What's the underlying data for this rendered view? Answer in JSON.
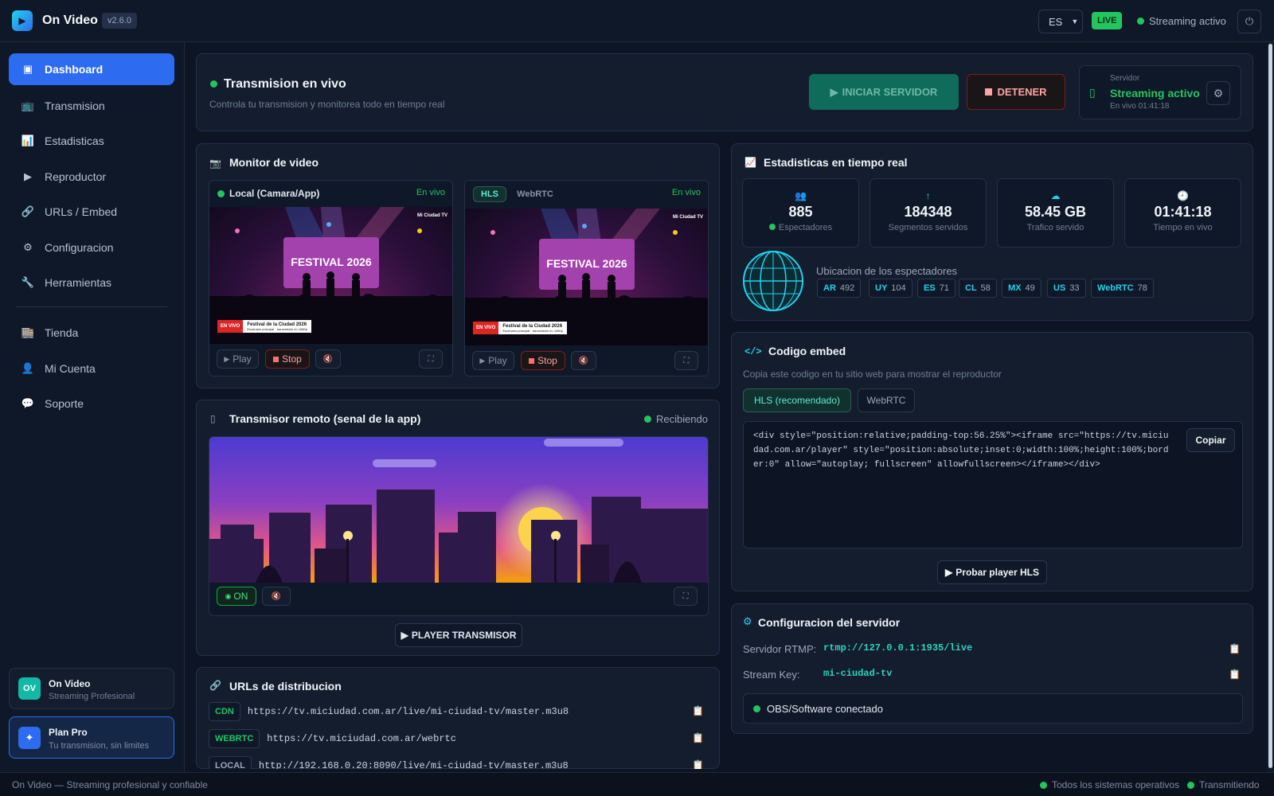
{
  "app": {
    "name": "On Video",
    "version": "v2.6.0"
  },
  "topbar": {
    "lang": "ES",
    "live_badge": "LIVE",
    "status": "Streaming activo"
  },
  "sidebar": {
    "items": [
      {
        "label": "Dashboard",
        "icon": "dashboard-icon"
      },
      {
        "label": "Transmision",
        "icon": "tv-icon"
      },
      {
        "label": "Estadisticas",
        "icon": "chart-icon"
      },
      {
        "label": "Reproductor",
        "icon": "play-icon"
      },
      {
        "label": "URLs / Embed",
        "icon": "link-icon"
      },
      {
        "label": "Configuracion",
        "icon": "gear-icon"
      },
      {
        "label": "Herramientas",
        "icon": "wrench-icon"
      },
      {
        "label": "Tienda",
        "icon": "store-icon"
      },
      {
        "label": "Mi Cuenta",
        "icon": "user-icon"
      },
      {
        "label": "Soporte",
        "icon": "chat-icon"
      }
    ],
    "brand_card": {
      "initials": "OV",
      "title": "On Video",
      "subtitle": "Streaming Profesional"
    },
    "plan_card": {
      "title": "Plan Pro",
      "subtitle": "Tu transmision, sin limites"
    }
  },
  "header": {
    "title": "Transmision en vivo",
    "subtitle": "Controla tu transmision y monitorea todo en tiempo real",
    "start_button": "INICIAR SERVIDOR",
    "stop_button": "DETENER",
    "server_label": "Servidor",
    "server_status": "Streaming activo",
    "server_uptime": "En vivo 01:41:18"
  },
  "monitor": {
    "title": "Monitor de video",
    "local": {
      "label": "Local (Camara/App)",
      "status": "En vivo"
    },
    "remote": {
      "tab_hls": "HLS",
      "tab_webrtc": "WebRTC",
      "status": "En vivo"
    },
    "thumb": {
      "headline": "FESTIVAL 2026",
      "channel": "Mi Ciudad TV",
      "live": "EN VIVO",
      "caption_title": "Festival de la Ciudad 2026",
      "caption_sub": "Escenario principal · transmisión en 1080p"
    },
    "play": "Play",
    "stop": "Stop"
  },
  "transmitter": {
    "title": "Transmisor remoto (senal de la app)",
    "status": "Recibiendo",
    "on_label": "ON",
    "player_button": "PLAYER TRANSMISOR"
  },
  "urls": {
    "title": "URLs de distribucion",
    "items": [
      {
        "tag": "CDN",
        "url": "https://tv.miciudad.com.ar/live/mi-ciudad-tv/master.m3u8"
      },
      {
        "tag": "WEBRTC",
        "url": "https://tv.miciudad.com.ar/webrtc"
      },
      {
        "tag": "LOCAL",
        "url": "http://192.168.0.20:8090/live/mi-ciudad-tv/master.m3u8"
      }
    ]
  },
  "stats": {
    "title": "Estadisticas en tiempo real",
    "cards": [
      {
        "value": "885",
        "label": "Espectadores",
        "icon": "users-icon"
      },
      {
        "value": "184348",
        "label": "Segmentos servidos",
        "icon": "arrow-up-icon"
      },
      {
        "value": "58.45 GB",
        "label": "Trafico servido",
        "icon": "cloud-icon"
      },
      {
        "value": "01:41:18",
        "label": "Tiempo en vivo",
        "icon": "clock-icon"
      }
    ],
    "location_title": "Ubicacion de los espectadores",
    "locations": [
      {
        "code": "AR",
        "count": "492"
      },
      {
        "code": "UY",
        "count": "104"
      },
      {
        "code": "ES",
        "count": "71"
      },
      {
        "code": "CL",
        "count": "58"
      },
      {
        "code": "MX",
        "count": "49"
      },
      {
        "code": "US",
        "count": "33"
      },
      {
        "code": "WebRTC",
        "count": "78"
      }
    ]
  },
  "embed": {
    "title": "Codigo embed",
    "subtitle": "Copia este codigo en tu sitio web para mostrar el reproductor",
    "tab_hls": "HLS (recomendado)",
    "tab_webrtc": "WebRTC",
    "code_lines": [
      "<div style=\"position:relative;padding-top:56.25%\"><iframe src=\"https://tv.miciu",
      "dad.com.ar/player\" style=\"position:absolute;inset:0;width:100%;height:100%;bord",
      "er:0\" allow=\"autoplay; fullscreen\" allowfullscreen></iframe></div>"
    ],
    "copy_button": "Copiar",
    "test_button": "Probar player HLS"
  },
  "server_config": {
    "title": "Configuracion del servidor",
    "rtmp_label": "Servidor RTMP:",
    "rtmp_value": "rtmp://127.0.0.1:1935/live",
    "key_label": "Stream Key:",
    "key_value": "mi-ciudad-tv",
    "obs_status": "OBS/Software conectado"
  },
  "footer": {
    "left": "On Video — Streaming profesional y confiable",
    "status1": "Todos los sistemas operativos",
    "status2": "Transmitiendo"
  },
  "colors": {
    "accent": "#2d6cf0",
    "live": "#22c55e",
    "teal": "#22d3ee",
    "danger": "#f87171"
  }
}
